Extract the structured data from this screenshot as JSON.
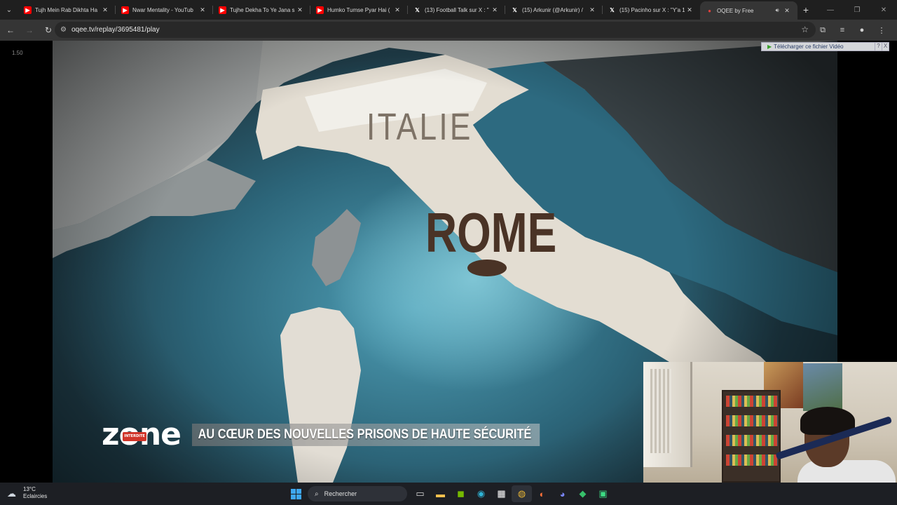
{
  "browser": {
    "tabs": [
      {
        "title": "Tujh Mein Rab Dikhta Ha",
        "favicon": "youtube-icon",
        "active": false
      },
      {
        "title": "Nwar Mentality - YouTub",
        "favicon": "youtube-icon",
        "active": false
      },
      {
        "title": "Tujhe Dekha To Ye Jana s",
        "favicon": "youtube-icon",
        "active": false
      },
      {
        "title": "Humko Tumse Pyar Hai (",
        "favicon": "youtube-icon",
        "active": false
      },
      {
        "title": "(13) Football Talk sur X : \"",
        "favicon": "x-icon",
        "active": false
      },
      {
        "title": "(15) Arkunir (@Arkunir) /",
        "favicon": "x-icon",
        "active": false
      },
      {
        "title": "(15) Pacinho sur X : \"Y'a 1",
        "favicon": "x-icon",
        "active": false
      },
      {
        "title": "OQEE by Free",
        "favicon": "oqee-icon",
        "active": true
      }
    ],
    "url": "oqee.tv/replay/3695481/play"
  },
  "player": {
    "speed": "1.50",
    "download_label": "Télécharger ce fichier Vidéo",
    "download_help": "?",
    "download_close": "X",
    "map_labels": {
      "country": "ITALIE",
      "city": "ROME"
    },
    "show_logo": "zone",
    "show_logo_badge": "INTERDITE",
    "banner_title": "AU CŒUR DES NOUVELLES PRISONS DE HAUTE SÉCURITÉ"
  },
  "taskbar": {
    "weather_temp": "13°C",
    "weather_desc": "Eclaircies",
    "search_placeholder": "Rechercher",
    "pinned_apps": [
      "task-view",
      "file-explorer",
      "nvidia",
      "edge",
      "store",
      "chrome",
      "firefox",
      "discord",
      "maps",
      "android"
    ]
  },
  "colors": {
    "youtube_red": "#ff0000",
    "oqee_red": "#e2403c",
    "zone_red": "#d0352a",
    "sea": "#4f9fb6"
  }
}
